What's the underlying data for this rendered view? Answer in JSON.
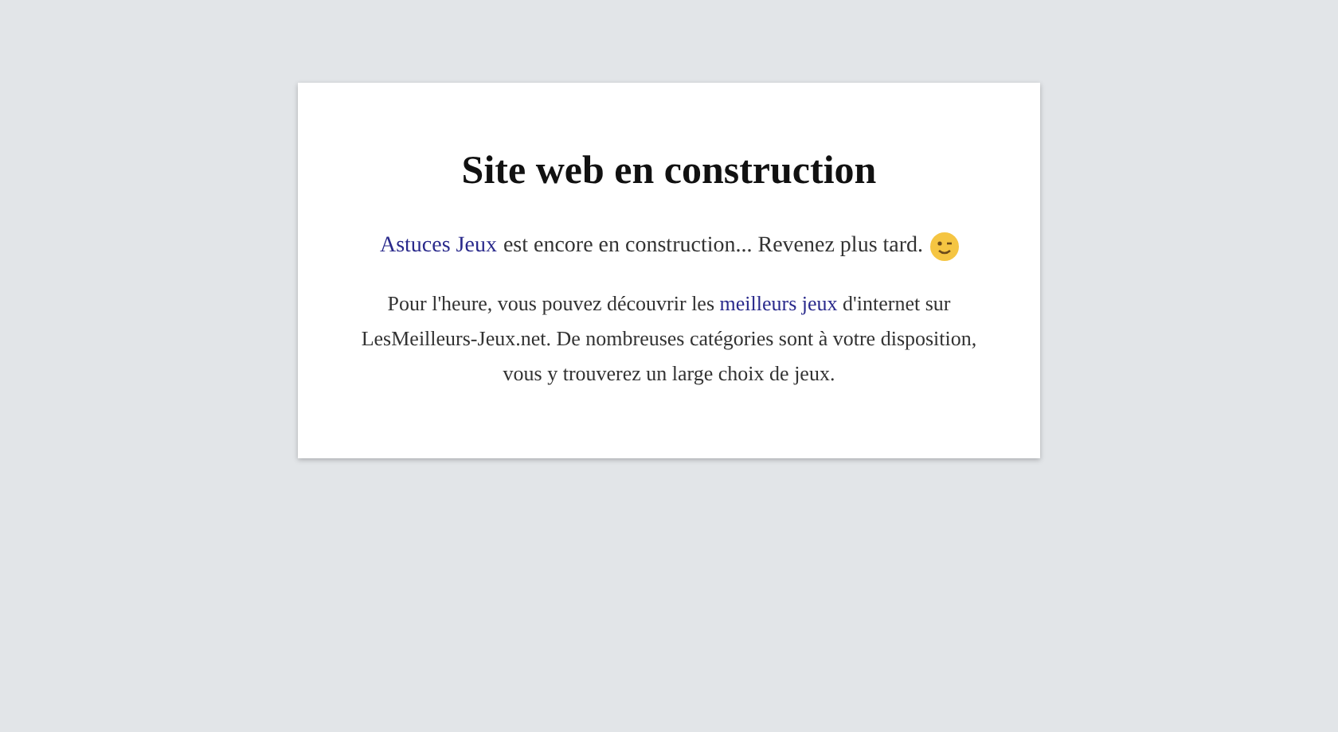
{
  "card": {
    "title": "Site web en construction",
    "intro": {
      "link": "Astuces Jeux",
      "text": "est encore en construction... Revenez plus tard."
    },
    "paragraph": {
      "before": "Pour l'heure, vous pouvez découvrir les",
      "link": "meilleurs jeux",
      "after": "d'internet sur LesMeilleurs-Jeux.net. De nombreuses catégories sont à votre disposition, vous y trouverez un large choix de jeux."
    }
  }
}
